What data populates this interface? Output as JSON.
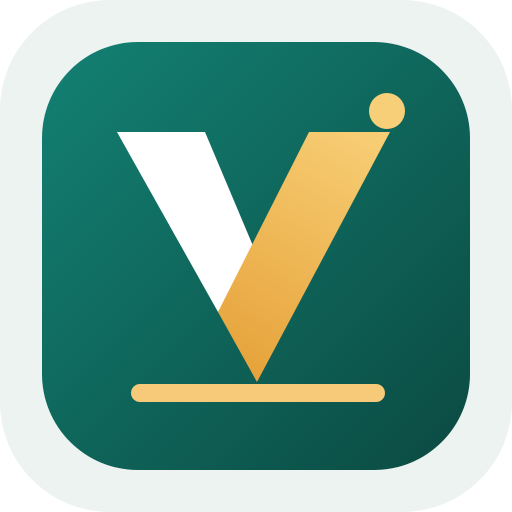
{
  "icon": {
    "name": "V logo app icon",
    "colors": {
      "outer_background": "#edf3f1",
      "tile_gradient_start": "#138173",
      "tile_gradient_end": "#0b4a42",
      "white_stroke": "#ffffff",
      "gold_light": "#f8cf76",
      "gold_dark": "#e6a23a",
      "base_bar": "#f6ca78",
      "dot": "#f7cf78"
    },
    "elements": [
      "white-diagonal-stroke",
      "gold-diagonal-stroke",
      "gold-dot",
      "gold-base-bar"
    ]
  }
}
